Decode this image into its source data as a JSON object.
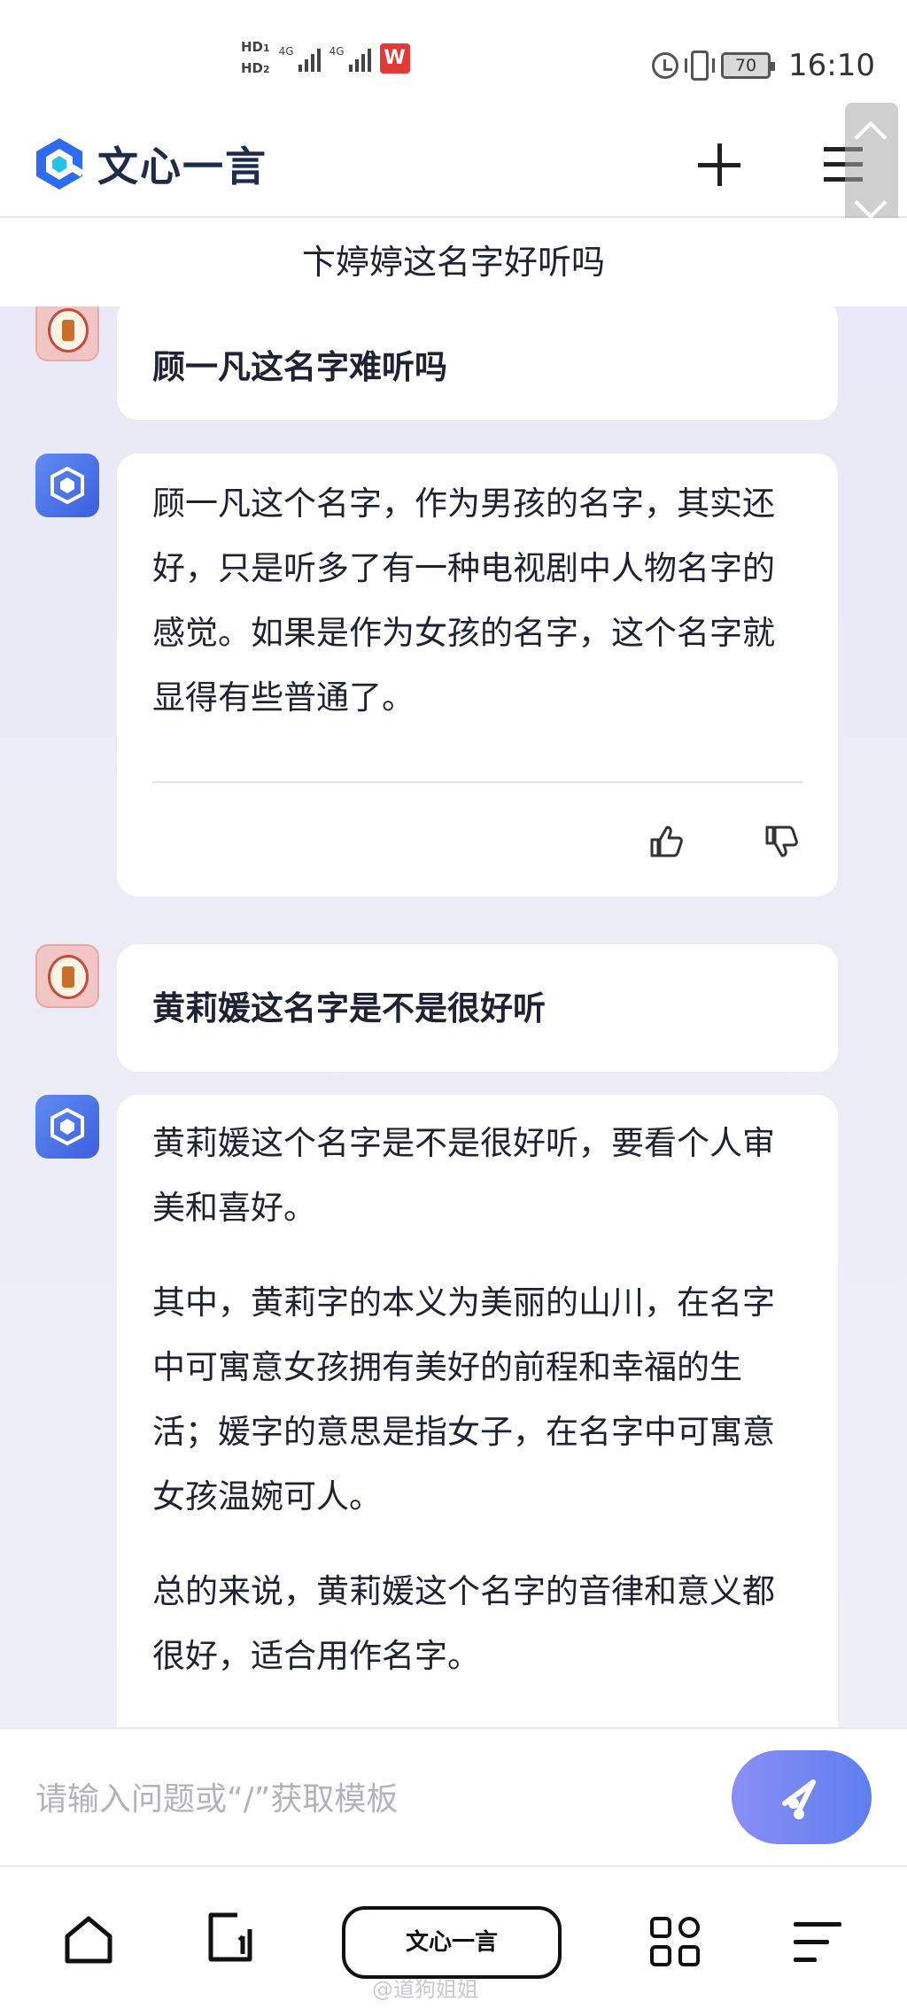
{
  "status_bar": {
    "hd1": "HD",
    "hd1_sub": "1",
    "hd2": "HD",
    "hd2_sub": "2",
    "net1": "4G",
    "net2": "4G",
    "app_badge": "W",
    "battery": "70",
    "time": "16:10"
  },
  "app": {
    "name": "文心一言",
    "brand_color": "#2f6bf0"
  },
  "conversation": {
    "title": "卞婷婷这名字好听吗"
  },
  "messages": [
    {
      "role": "user",
      "text": "顾一凡这名字难听吗"
    },
    {
      "role": "bot",
      "paragraphs": [
        "顾一凡这个名字，作为男孩的名字，其实还好，只是听多了有一种电视剧中人物名字的感觉。如果是作为女孩的名字，这个名字就显得有些普通了。"
      ]
    },
    {
      "role": "user",
      "text": "黄莉媛这名字是不是很好听"
    },
    {
      "role": "bot",
      "paragraphs": [
        "黄莉媛这个名字是不是很好听，要看个人审美和喜好。",
        "其中，黄莉字的本义为美丽的山川，在名字中可寓意女孩拥有美好的前程和幸福的生活；媛字的意思是指女子，在名字中可寓意女孩温婉可人。",
        "总的来说，黄莉媛这个名字的音律和意义都很好，适合用作名字。"
      ]
    }
  ],
  "input": {
    "placeholder": "请输入问题或“/”获取模板"
  },
  "bottom_nav": {
    "center_label": "文心一言"
  },
  "watermark": {
    "weibo": "@道狗姐姐"
  }
}
